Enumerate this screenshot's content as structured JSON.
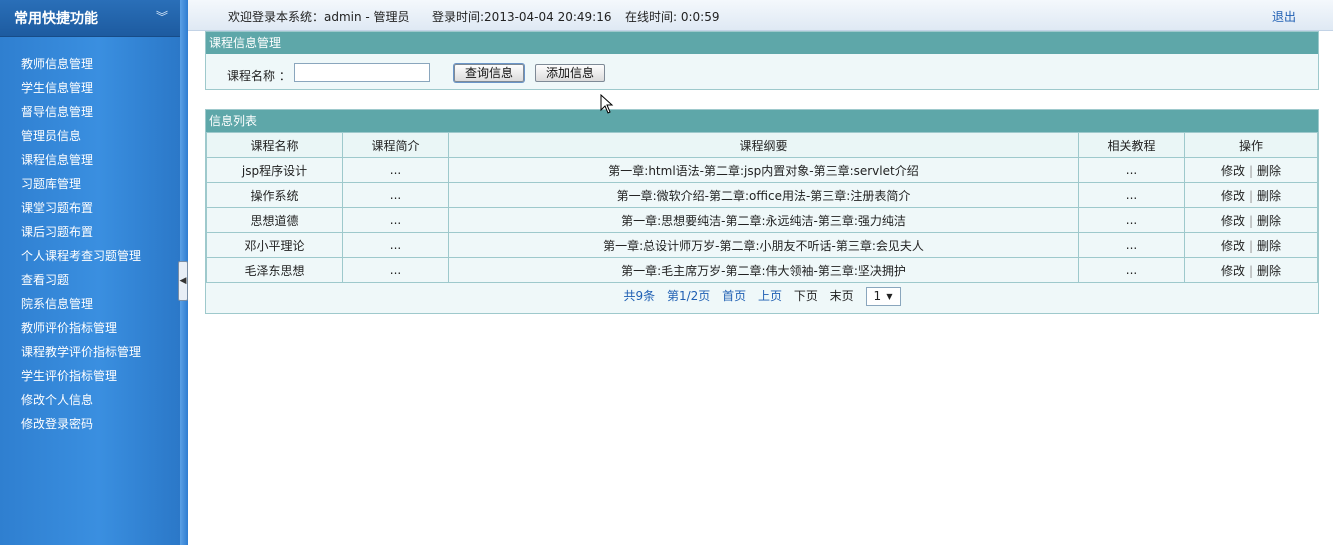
{
  "sidebar": {
    "title": "常用快捷功能",
    "collapse_icon": "double-chevron-down-icon",
    "items": [
      {
        "label": "教师信息管理"
      },
      {
        "label": "学生信息管理"
      },
      {
        "label": "督导信息管理"
      },
      {
        "label": "管理员信息"
      },
      {
        "label": "课程信息管理"
      },
      {
        "label": "习题库管理"
      },
      {
        "label": "课堂习题布置"
      },
      {
        "label": "课后习题布置"
      },
      {
        "label": "个人课程考查习题管理"
      },
      {
        "label": "查看习题"
      },
      {
        "label": "院系信息管理"
      },
      {
        "label": "教师评价指标管理"
      },
      {
        "label": "课程教学评价指标管理"
      },
      {
        "label": "学生评价指标管理"
      },
      {
        "label": "修改个人信息"
      },
      {
        "label": "修改登录密码"
      }
    ]
  },
  "topbar": {
    "welcome": "欢迎登录本系统：admin - 管理员",
    "login_time": "登录时间:2013-04-04 20:49:16",
    "online_time": "在线时间: 0:0:59",
    "logout": "退出"
  },
  "search": {
    "title": "课程信息管理",
    "label": "课程名称 ：",
    "value": "",
    "query_button": "查询信息",
    "add_button": "添加信息"
  },
  "list": {
    "title": "信息列表",
    "columns": [
      "课程名称",
      "课程简介",
      "课程纲要",
      "相关教程",
      "操作"
    ],
    "rows": [
      {
        "name": "jsp程序设计",
        "intro": "...",
        "outline": "第一章:html语法-第二章:jsp内置对象-第三章:servlet介绍",
        "tutorial": "...",
        "edit": "修改",
        "delete": "删除"
      },
      {
        "name": "操作系统",
        "intro": "...",
        "outline": "第一章:微软介绍-第二章:office用法-第三章:注册表简介",
        "tutorial": "...",
        "edit": "修改",
        "delete": "删除"
      },
      {
        "name": "思想道德",
        "intro": "...",
        "outline": "第一章:思想要纯洁-第二章:永远纯洁-第三章:强力纯洁",
        "tutorial": "...",
        "edit": "修改",
        "delete": "删除"
      },
      {
        "name": "邓小平理论",
        "intro": "...",
        "outline": "第一章:总设计师万岁-第二章:小朋友不听话-第三章:会见夫人",
        "tutorial": "...",
        "edit": "修改",
        "delete": "删除"
      },
      {
        "name": "毛泽东思想",
        "intro": "...",
        "outline": "第一章:毛主席万岁-第二章:伟大领袖-第三章:坚决拥护",
        "tutorial": "...",
        "edit": "修改",
        "delete": "删除"
      }
    ],
    "separator": "|"
  },
  "pager": {
    "total": "共9条",
    "page": "第1/2页",
    "first": "首页",
    "prev": "上页",
    "next": "下页",
    "last": "末页",
    "selected": "1"
  },
  "icons": {
    "cursor": "mouse-pointer-icon",
    "splitter": "collapse-left-icon"
  },
  "colors": {
    "sidebar": "#3a8fe0",
    "panel_header": "#5ea7a9",
    "link": "#1f5fb3"
  }
}
